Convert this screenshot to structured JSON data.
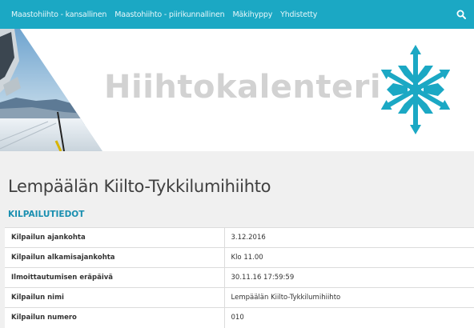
{
  "nav": {
    "items": [
      "Maastohiihto - kansallinen",
      "Maastohiihto - piirikunnallinen",
      "Mäkihyppy",
      "Yhdistetty"
    ],
    "search_icon": "search-icon"
  },
  "hero": {
    "title": "Hiihtokalenteri",
    "logo_icon": "snowflake-logo-icon",
    "photo": "ski-track-photo",
    "colors": {
      "logo": "#1ba8c4",
      "title": "#d2d2d2"
    }
  },
  "page": {
    "title": "Lempäälän Kiilto-Tykkilumihiihto",
    "section_title": "KILPAILUTIEDOT"
  },
  "details": [
    {
      "label": "Kilpailun ajankohta",
      "value": "3.12.2016"
    },
    {
      "label": "Kilpailun alkamisajankohta",
      "value": "Klo 11.00"
    },
    {
      "label": "Ilmoittautumisen eräpäivä",
      "value": "30.11.16 17:59:59"
    },
    {
      "label": "Kilpailun nimi",
      "value": "Lempäälän Kiilto-Tykkilumihiihto"
    },
    {
      "label": "Kilpailun numero",
      "value": "010"
    }
  ],
  "colors": {
    "nav_bg": "#1ba8c4",
    "section_title": "#1a8fb0",
    "page_bg": "#f0f0f0"
  }
}
